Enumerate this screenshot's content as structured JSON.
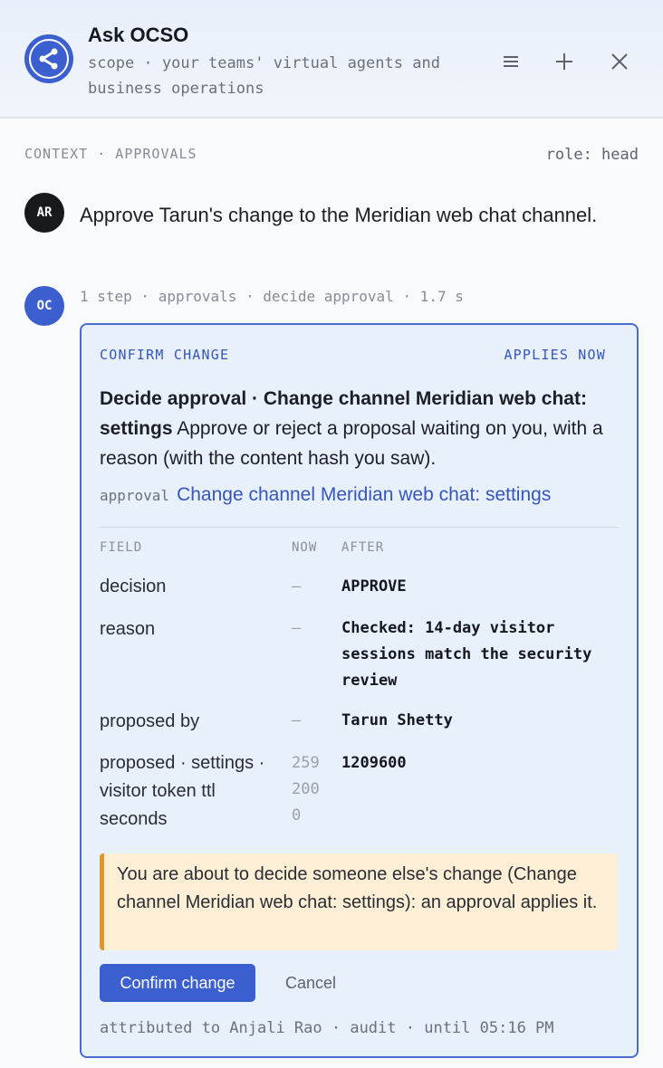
{
  "header": {
    "title": "Ask OCSO",
    "subtitle": "scope · your teams' virtual agents and business operations",
    "logo_icon": "share-network-icon",
    "actions": [
      {
        "name": "menu",
        "icon": "hamburger-menu-icon"
      },
      {
        "name": "new",
        "icon": "plus-icon"
      },
      {
        "name": "close",
        "icon": "close-icon"
      }
    ]
  },
  "context": {
    "label": "CONTEXT · APPROVALS",
    "role": "role: head"
  },
  "user_message": {
    "initials": "AR",
    "text": "Approve Tarun's change to the Meridian web chat channel."
  },
  "agent": {
    "initials": "OC",
    "step_line": "1 step · approvals · decide approval · 1.7 s"
  },
  "card": {
    "label": "CONFIRM CHANGE",
    "applies": "APPLIES NOW",
    "title": "Decide approval · Change channel Meridian web chat: settings",
    "description": "Approve or reject a proposal waiting on you, with a reason (with the content hash you saw).",
    "approval_key": "approval",
    "approval_link": "Change channel Meridian web chat: settings",
    "columns": {
      "field": "FIELD",
      "now": "NOW",
      "after": "AFTER"
    },
    "rows": [
      {
        "field": "decision",
        "now": "—",
        "after": "APPROVE"
      },
      {
        "field": "reason",
        "now": "—",
        "after": "Checked: 14-day visitor sessions match the security review"
      },
      {
        "field": "proposed by",
        "now": "—",
        "after": "Tarun Shetty"
      },
      {
        "field": "proposed · settings · visitor token ttl seconds",
        "now": "2592000",
        "after": "1209600"
      }
    ],
    "warning": "You are about to decide someone else's change (Change channel Meridian web chat: settings): an approval applies it.",
    "confirm_label": "Confirm change",
    "cancel_label": "Cancel",
    "attribution": "attributed to Anjali Rao · audit · until 05:16 PM"
  },
  "colors": {
    "accent": "#3c5fcf",
    "card_bg": "#e8f0fc",
    "warning_bg": "#fdefd6",
    "warning_border": "#e0952a"
  }
}
